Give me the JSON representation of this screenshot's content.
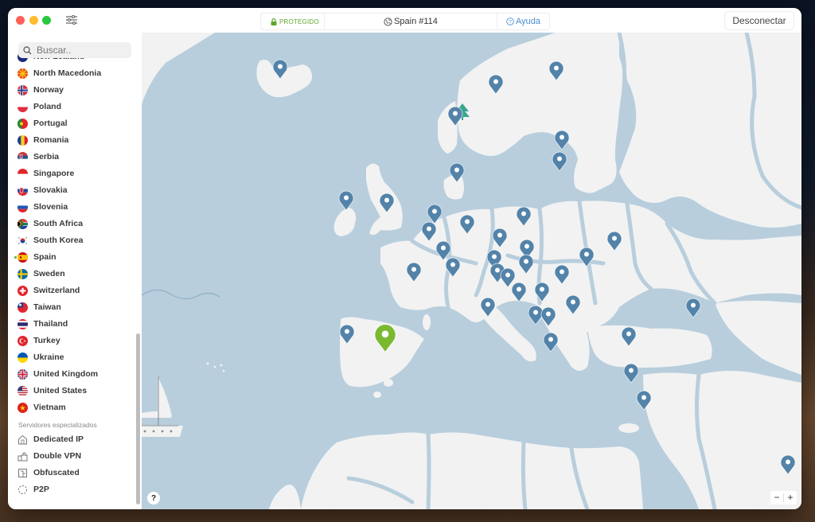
{
  "window": {
    "status": {
      "protection_label": "PROTEGIDO",
      "server_label": "Spain #114",
      "help_label": "Ayuda"
    },
    "disconnect_label": "Desconectar"
  },
  "colors": {
    "accent_green": "#5ea72c",
    "pin_blue": "#5383a9",
    "pin_active": "#7bb930",
    "map_water": "#b8cedd",
    "map_land": "#f2f2f2",
    "link_blue": "#4a8fd1"
  },
  "sidebar": {
    "search_placeholder": "Buscar..",
    "countries": [
      {
        "label": "New Zealand",
        "flag": "nz-flag-icon",
        "partial": true
      },
      {
        "label": "North Macedonia",
        "flag": "mk-flag-icon"
      },
      {
        "label": "Norway",
        "flag": "no-flag-icon"
      },
      {
        "label": "Poland",
        "flag": "pl-flag-icon"
      },
      {
        "label": "Portugal",
        "flag": "pt-flag-icon"
      },
      {
        "label": "Romania",
        "flag": "ro-flag-icon"
      },
      {
        "label": "Serbia",
        "flag": "rs-flag-icon"
      },
      {
        "label": "Singapore",
        "flag": "sg-flag-icon"
      },
      {
        "label": "Slovakia",
        "flag": "sk-flag-icon"
      },
      {
        "label": "Slovenia",
        "flag": "si-flag-icon"
      },
      {
        "label": "South Africa",
        "flag": "za-flag-icon"
      },
      {
        "label": "South Korea",
        "flag": "kr-flag-icon"
      },
      {
        "label": "Spain",
        "flag": "es-flag-icon",
        "connected": true
      },
      {
        "label": "Sweden",
        "flag": "se-flag-icon"
      },
      {
        "label": "Switzerland",
        "flag": "ch-flag-icon"
      },
      {
        "label": "Taiwan",
        "flag": "tw-flag-icon"
      },
      {
        "label": "Thailand",
        "flag": "th-flag-icon"
      },
      {
        "label": "Turkey",
        "flag": "tr-flag-icon"
      },
      {
        "label": "Ukraine",
        "flag": "ua-flag-icon"
      },
      {
        "label": "United Kingdom",
        "flag": "gb-flag-icon"
      },
      {
        "label": "United States",
        "flag": "us-flag-icon"
      },
      {
        "label": "Vietnam",
        "flag": "vn-flag-icon"
      }
    ],
    "specialty_section_label": "Servidores especializados",
    "specialty": [
      {
        "label": "Dedicated IP",
        "icon": "house-icon"
      },
      {
        "label": "Double VPN",
        "icon": "double-lock-icon"
      },
      {
        "label": "Obfuscated",
        "icon": "obfuscated-icon"
      },
      {
        "label": "P2P",
        "icon": "p2p-icon"
      }
    ]
  },
  "map": {
    "help_label": "?",
    "zoom_out_label": "−",
    "zoom_in_label": "+",
    "active_server": "Spain"
  }
}
